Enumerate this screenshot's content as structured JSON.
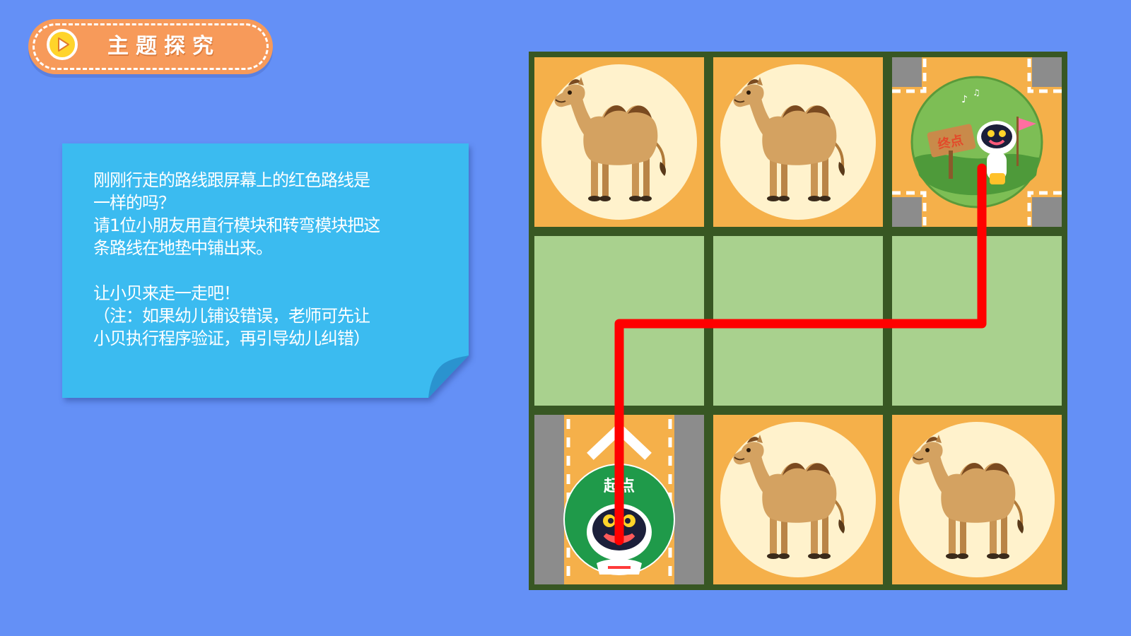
{
  "header": {
    "title": "主题探究",
    "play_icon": "play-circle-icon",
    "colors": {
      "badge": "#F79A5A",
      "play": "#FFD42A"
    }
  },
  "note": {
    "line1": "刚刚行走的路线跟屏幕上的红色路线是",
    "line2": "一样的吗？",
    "line3": "请1位小朋友用直行模块和转弯模块把这",
    "line4": "条路线在地垫中铺出来。",
    "line5": "让小贝来走一走吧！",
    "line6": "（注：如果幼儿铺设错误，老师可先让",
    "line7": "小贝执行程序验证，再引导幼儿纠错）",
    "color": "#3BBBF0"
  },
  "map": {
    "grid": "3x3",
    "colors": {
      "border": "#385723",
      "tile": "#F5B04A",
      "path_tile": "#A9D18E",
      "route": "#FF0000"
    },
    "tiles": [
      {
        "row": 1,
        "col": 1,
        "type": "camel-icon"
      },
      {
        "row": 1,
        "col": 2,
        "type": "camel-icon"
      },
      {
        "row": 1,
        "col": 3,
        "type": "finish-icon"
      },
      {
        "row": 2,
        "col": 1,
        "type": "green-path"
      },
      {
        "row": 2,
        "col": 2,
        "type": "green-path"
      },
      {
        "row": 2,
        "col": 3,
        "type": "green-path"
      },
      {
        "row": 3,
        "col": 1,
        "type": "start-road"
      },
      {
        "row": 3,
        "col": 2,
        "type": "camel-icon"
      },
      {
        "row": 3,
        "col": 3,
        "type": "camel-icon"
      }
    ],
    "start_label": "起点",
    "end_label": "终点"
  }
}
